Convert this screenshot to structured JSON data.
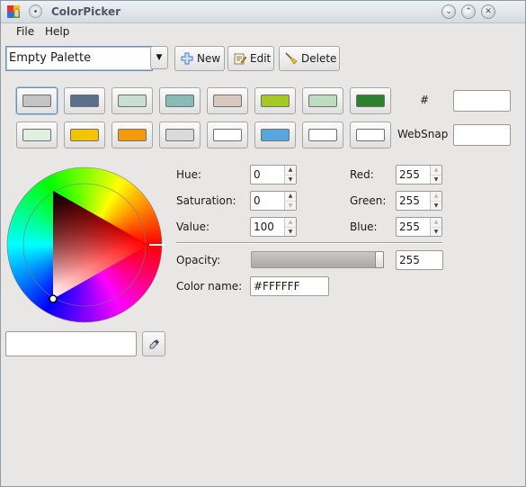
{
  "window": {
    "title": "ColorPicker"
  },
  "menu": {
    "file": "File",
    "help": "Help"
  },
  "palette": {
    "selected": "Empty Palette"
  },
  "toolbar": {
    "new_label": "New",
    "edit_label": "Edit",
    "delete_label": "Delete"
  },
  "swatches": [
    [
      "#c4c4c4",
      "#5a7189",
      "#c9dfd6",
      "#86bcb5",
      "#d9c8c2",
      "#a5c825",
      "#bfdcc0",
      "#2c812f"
    ],
    [
      "#e0f0de",
      "#f5c400",
      "#f49b0d",
      "#dadada",
      "#ffffff",
      "#55a7dd",
      "#ffffff",
      "#ffffff"
    ]
  ],
  "hex": {
    "label": "#",
    "value": ""
  },
  "websnap": {
    "label": "WebSnap",
    "value": ""
  },
  "hsv": {
    "hue_label": "Hue:",
    "hue": "0",
    "saturation_label": "Saturation:",
    "saturation": "0",
    "value_label": "Value:",
    "value": "100"
  },
  "rgb": {
    "red_label": "Red:",
    "red": "255",
    "green_label": "Green:",
    "green": "255",
    "blue_label": "Blue:",
    "blue": "255"
  },
  "opacity": {
    "label": "Opacity:",
    "value": "255",
    "fraction": 1.0
  },
  "color_name": {
    "label": "Color name:",
    "value": "#FFFFFF"
  },
  "preview": {
    "value": ""
  },
  "icons": {
    "app": "app-icon",
    "pin": "pin-icon",
    "minimize": "minimize-icon",
    "maximize": "maximize-icon",
    "new": "plus-icon",
    "edit": "edit-icon",
    "delete": "broom-icon",
    "eyedropper": "eyedropper-icon"
  }
}
